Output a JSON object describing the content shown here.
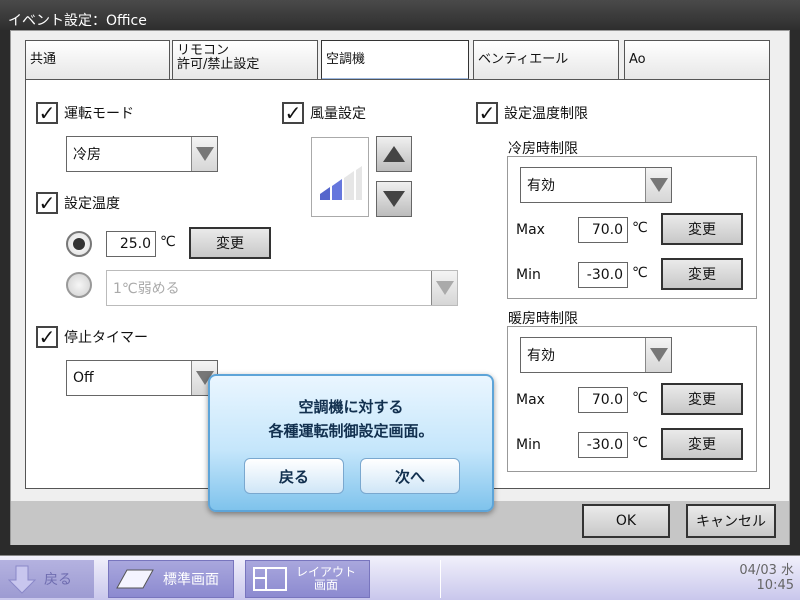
{
  "window": {
    "title": "イベント設定：Office"
  },
  "tabs": [
    {
      "label": "共通"
    },
    {
      "label_line1": "リモコン",
      "label_line2": "許可/禁止設定"
    },
    {
      "label": "空調機"
    },
    {
      "label": "ベンティエール"
    },
    {
      "label": "Ao"
    }
  ],
  "op_mode": {
    "label": "運転モード",
    "checked": true,
    "value": "冷房"
  },
  "fan": {
    "label": "風量設定",
    "checked": true
  },
  "setpoint": {
    "label": "設定温度",
    "checked": true,
    "value": "25.0",
    "unit": "℃",
    "change_label": "変更",
    "relative_option": "1℃弱める"
  },
  "stop_timer": {
    "label": "停止タイマー",
    "checked": true,
    "value": "Off"
  },
  "setpoint_limit": {
    "label": "設定温度制限",
    "checked": true,
    "cooling": {
      "title": "冷房時制限",
      "mode": "有効",
      "max_label": "Max",
      "max_value": "70.0",
      "min_label": "Min",
      "min_value": "-30.0",
      "unit": "℃",
      "change_label": "変更"
    },
    "heating": {
      "title": "暖房時制限",
      "mode": "有効",
      "max_label": "Max",
      "max_value": "70.0",
      "min_label": "Min",
      "min_value": "-30.0",
      "unit": "℃",
      "change_label": "変更"
    }
  },
  "footer": {
    "ok_label": "OK",
    "cancel_label": "キャンセル"
  },
  "dialog": {
    "line1": "空調機に対する",
    "line2": "各種運転制御設定画面。",
    "back_label": "戻る",
    "next_label": "次へ"
  },
  "taskbar": {
    "back_label": "戻る",
    "standard_label": "標準画面",
    "layout_line1": "レイアウト",
    "layout_line2": "画面",
    "date": "04/03 水",
    "time": "10:45"
  },
  "colors": {
    "accent": "#5da4d8",
    "taskbar": "#a9a7dd"
  }
}
